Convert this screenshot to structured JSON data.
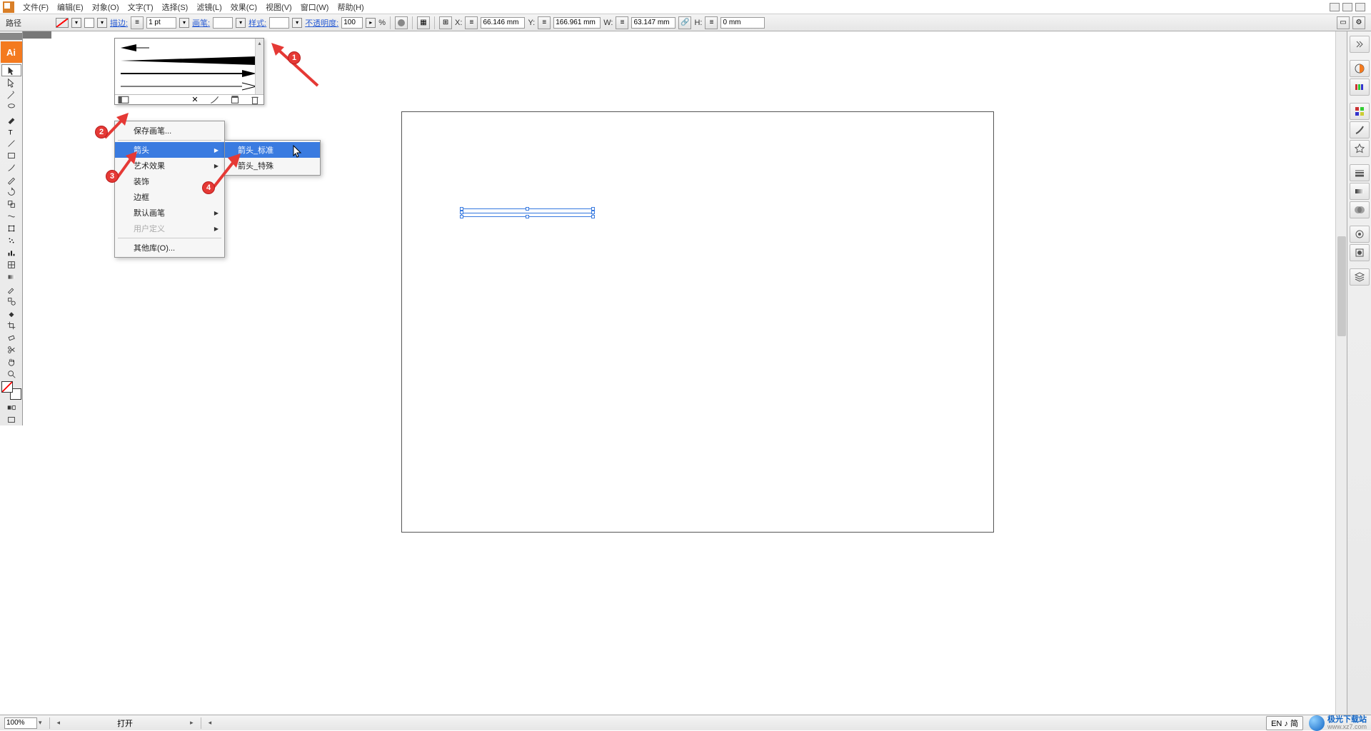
{
  "menubar": {
    "file": "文件(F)",
    "edit": "编辑(E)",
    "object": "对象(O)",
    "type": "文字(T)",
    "select": "选择(S)",
    "filter": "滤镜(L)",
    "effect": "效果(C)",
    "view": "视图(V)",
    "window": "窗口(W)",
    "help": "帮助(H)"
  },
  "options": {
    "tool_label": "路径",
    "stroke_label": "描边:",
    "stroke_val": "1 pt",
    "brush_label": "画笔:",
    "style_label": "样式:",
    "opacity_label": "不透明度:",
    "opacity_val": "100",
    "opacity_unit": "%",
    "x_label": "X:",
    "x_val": "66.146 mm",
    "y_label": "Y:",
    "y_val": "166.961 mm",
    "w_label": "W:",
    "w_val": "63.147 mm",
    "h_label": "H:",
    "h_val": "0 mm"
  },
  "toolbox_logo": "Ai",
  "context_menu": {
    "save_brush": "保存画笔...",
    "arrow": "箭头",
    "artistic": "艺术效果",
    "decor": "装饰",
    "border": "边框",
    "default_brushes": "默认画笔",
    "user_defined": "用户定义",
    "other_lib": "其他库(O)..."
  },
  "submenu": {
    "arrow_standard": "箭头_标准",
    "arrow_special": "箭头_特殊"
  },
  "callouts": {
    "b1": "1",
    "b2": "2",
    "b3": "3",
    "b4": "4"
  },
  "status": {
    "zoom": "100%",
    "doc": "打开",
    "ime": "EN ♪ 简",
    "wm_name": "极光下载站",
    "wm_url": "www.xz7.com"
  }
}
